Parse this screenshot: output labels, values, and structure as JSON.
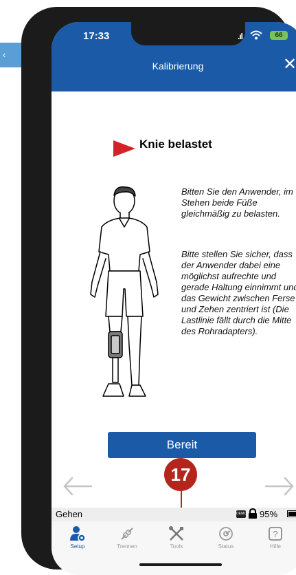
{
  "side_tab": {
    "arrow_glyph": "‹"
  },
  "status": {
    "time": "17:33",
    "battery": "66"
  },
  "nav": {
    "title": "Kalibrierung",
    "close_label": "✕"
  },
  "step": {
    "title": "Knie belastet",
    "paragraph1": "Bitten Sie den Anwender, im Stehen beide Füße gleichmäßig zu belasten.",
    "paragraph2": "Bitte stellen Sie sicher, dass der Anwender dabei eine möglichst aufrechte und gerade Haltung einnimmt und das Gewicht zwischen Ferse und Zehen zentriert ist (Die Lastlinie fällt durch die Mitte des Rohradapters)."
  },
  "ready_button": "Bereit",
  "callout_number": "17",
  "device_status": {
    "mode": "Gehen",
    "demo_label": "DEMO",
    "battery_percent": "95%"
  },
  "tabs": [
    {
      "label": "Setup",
      "icon": "person-gear-icon",
      "active": true
    },
    {
      "label": "Trennen",
      "icon": "unlink-icon",
      "active": false
    },
    {
      "label": "Tools",
      "icon": "tools-icon",
      "active": false
    },
    {
      "label": "Status",
      "icon": "status-icon",
      "active": false
    },
    {
      "label": "Hilfe",
      "icon": "help-icon",
      "active": false
    }
  ],
  "colors": {
    "primary": "#1a5aa7",
    "accent_red": "#d2232a",
    "callout": "#b3261e"
  }
}
